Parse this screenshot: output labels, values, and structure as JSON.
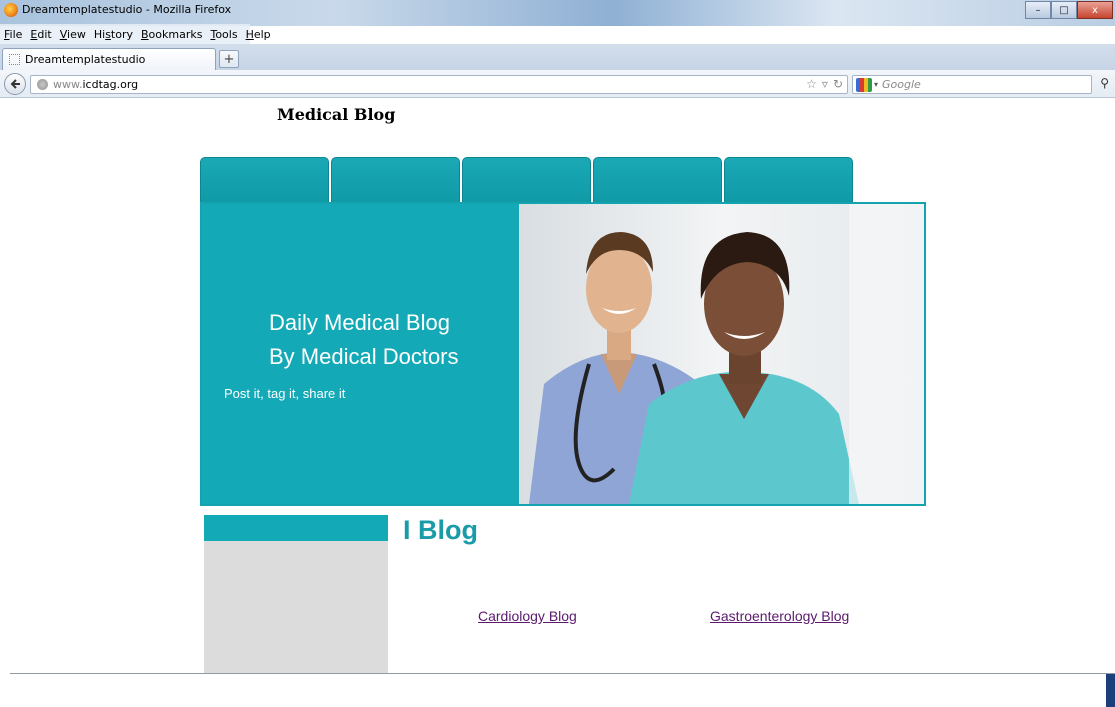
{
  "browser": {
    "window_title": "Dreamtemplatestudio - Mozilla Firefox",
    "menu": [
      {
        "pre": "",
        "key": "F",
        "post": "ile"
      },
      {
        "pre": "",
        "key": "E",
        "post": "dit"
      },
      {
        "pre": "",
        "key": "V",
        "post": "iew"
      },
      {
        "pre": "Hi",
        "key": "s",
        "post": "tory"
      },
      {
        "pre": "",
        "key": "B",
        "post": "ookmarks"
      },
      {
        "pre": "",
        "key": "T",
        "post": "ools"
      },
      {
        "pre": "",
        "key": "H",
        "post": "elp"
      }
    ],
    "tab_label": "Dreamtemplatestudio",
    "new_tab": "+",
    "url_prefix": "www.",
    "url_domain": "icdtag.org",
    "search_placeholder": "Google",
    "window_buttons": [
      "–",
      "□",
      "x"
    ]
  },
  "site": {
    "title": "Medical Blog",
    "hero": {
      "line1": "Daily Medical Blog",
      "line2": "By Medical Doctors",
      "tagline": "Post it, tag it, share it"
    },
    "section_heading": "I Blog",
    "links": [
      "Cardiology Blog",
      "Gastroenterology Blog"
    ]
  },
  "colors": {
    "accent": "#14a9b6",
    "link": "#5b1a6e",
    "heading": "#1a9ca8"
  }
}
